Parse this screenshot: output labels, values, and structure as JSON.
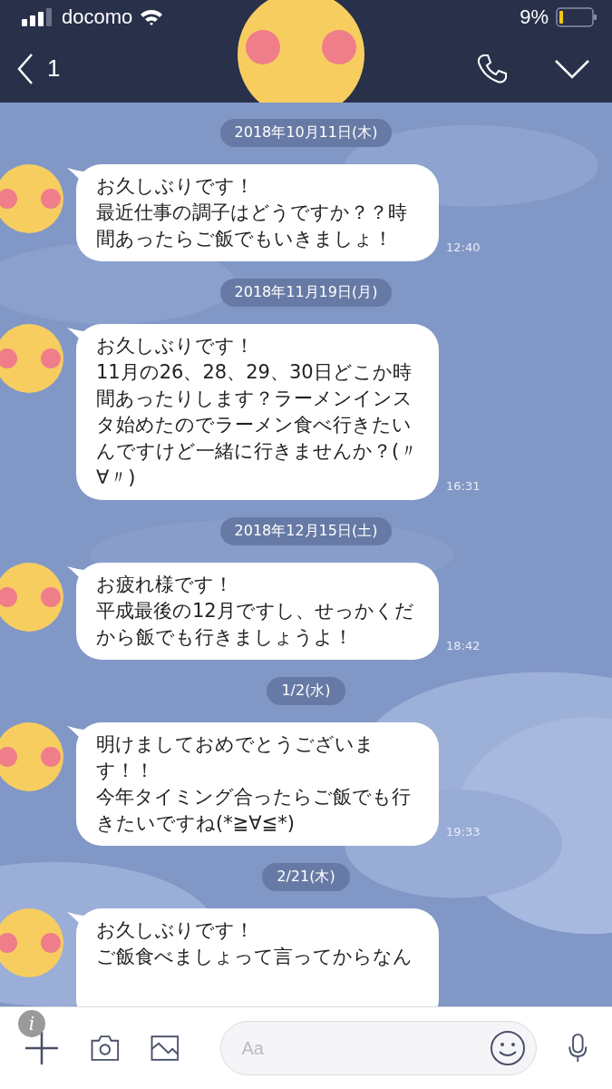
{
  "status_bar": {
    "carrier": "docomo",
    "battery": "9%"
  },
  "header": {
    "unread_count": "1"
  },
  "timeline": [
    {
      "kind": "date",
      "text": "2018年10月11日(木)"
    },
    {
      "kind": "message",
      "paragraphs": [
        "お久しぶりです！",
        "最近仕事の調子はどうですか？？時間あったらご飯でもいきましょ！"
      ],
      "time": "12:40"
    },
    {
      "kind": "date",
      "text": "2018年11月19日(月)"
    },
    {
      "kind": "message",
      "paragraphs": [
        "お久しぶりです！",
        "11月の26、28、29、30日どこか時間あったりします？ラーメンインスタ始めたのでラーメン食べ行きたいんですけど一緒に行きませんか？(〃∀〃)"
      ],
      "time": "16:31"
    },
    {
      "kind": "date",
      "text": "2018年12月15日(土)"
    },
    {
      "kind": "message",
      "paragraphs": [
        "お疲れ様です！",
        "平成最後の12月ですし、せっかくだから飯でも行きましょうよ！"
      ],
      "time": "18:42"
    },
    {
      "kind": "date",
      "text": "1/2(水)"
    },
    {
      "kind": "message",
      "paragraphs": [
        "明けましておめでとうございます！！",
        "今年タイミング合ったらご飯でも行きたいですね(*≧∀≦*)"
      ],
      "time": "19:33"
    },
    {
      "kind": "date",
      "text": "2/21(木)"
    },
    {
      "kind": "message",
      "paragraphs": [
        "お久しぶりです！",
        "ご飯食べましょって言ってからなん"
      ]
    }
  ],
  "input_bar": {
    "info_badge": "i",
    "placeholder": "Aa"
  }
}
